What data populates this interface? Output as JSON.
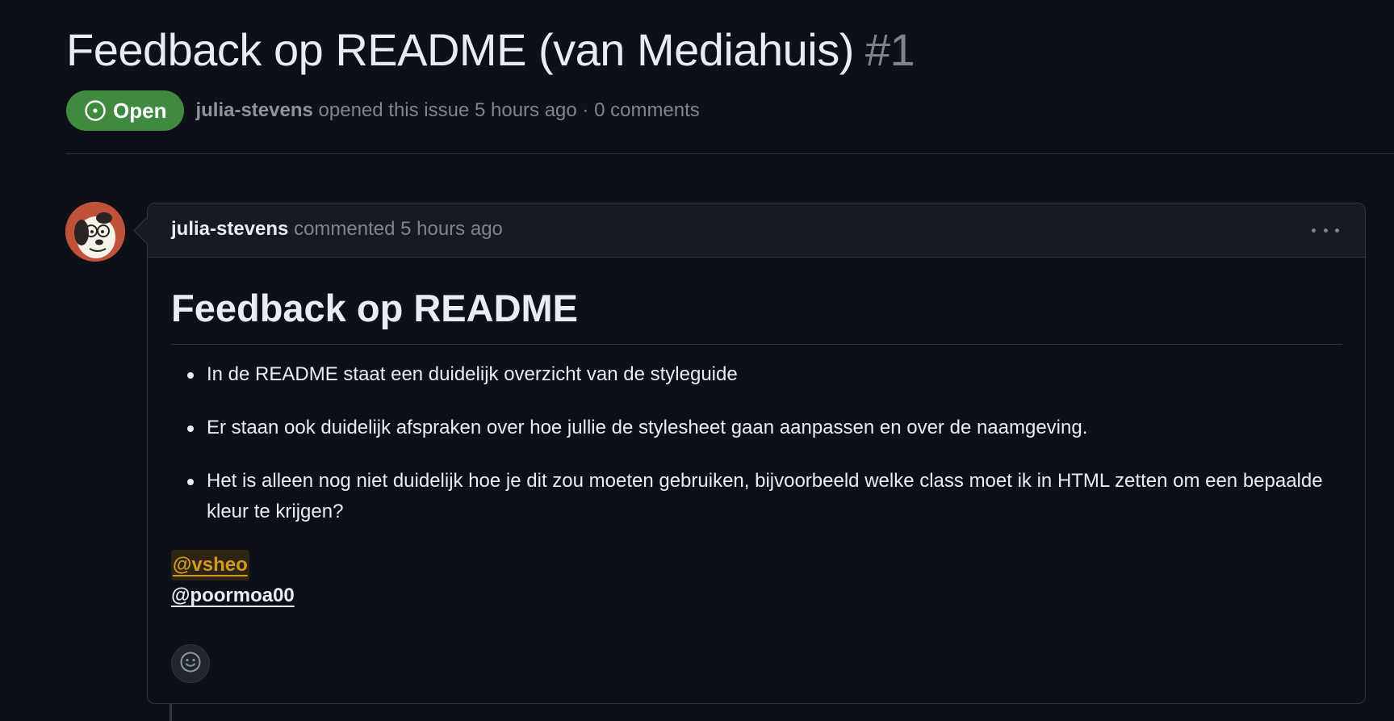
{
  "issue": {
    "title": "Feedback op README (van Mediahuis)",
    "number": "#1",
    "state": "Open",
    "author": "julia-stevens",
    "meta": " opened this issue 5 hours ago · 0 comments"
  },
  "comment": {
    "author": "julia-stevens",
    "meta": " commented 5 hours ago",
    "heading": "Feedback op README",
    "bullets": [
      "In de README staat een duidelijk overzicht van de styleguide",
      "Er staan ook duidelijk afspraken over hoe jullie de stylesheet gaan aanpassen en over de naamgeving.",
      "Het is alleen nog niet duidelijk hoe je dit zou moeten gebruiken, bijvoorbeeld welke class moet ik in HTML zetten om een bepaalde kleur te krijgen?"
    ],
    "mentions": [
      "@vsheo",
      "@poormoa00"
    ]
  },
  "icons": {
    "state": "issue-opened-icon",
    "menu": "kebab-horizontal-icon",
    "reaction": "smiley-icon"
  },
  "colors": {
    "background": "#0d1117",
    "open_badge": "#3f8a3f",
    "mention_highlight": "#d29922",
    "muted_text": "#7d8590"
  }
}
